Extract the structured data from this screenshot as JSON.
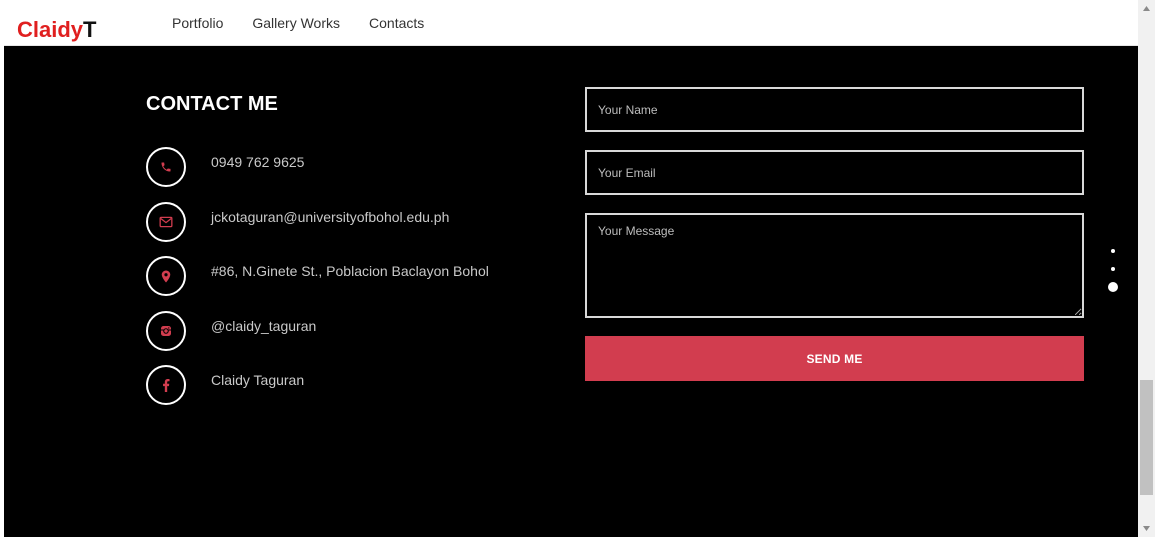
{
  "nav": {
    "brand_main": "Claidy",
    "brand_suffix": "T",
    "links": [
      "Portfolio",
      "Gallery Works",
      "Contacts"
    ]
  },
  "contact": {
    "title": "CONTACT ME",
    "items": [
      {
        "icon": "phone-icon",
        "text": "0949 762 9625"
      },
      {
        "icon": "envelope-icon",
        "text": "jckotaguran@universityofbohol.edu.ph"
      },
      {
        "icon": "map-pin-icon",
        "text": "#86, N.Ginete St., Poblacion Baclayon Bohol"
      },
      {
        "icon": "instagram-icon",
        "text": "@claidy_taguran"
      },
      {
        "icon": "facebook-icon",
        "text": "Claidy Taguran"
      }
    ]
  },
  "form": {
    "name_placeholder": "Your Name",
    "email_placeholder": "Your Email",
    "message_placeholder": "Your Message",
    "submit_label": "SEND ME"
  },
  "colors": {
    "brand_red": "#e01f1f",
    "accent": "#d23d4f",
    "background": "#000000"
  }
}
